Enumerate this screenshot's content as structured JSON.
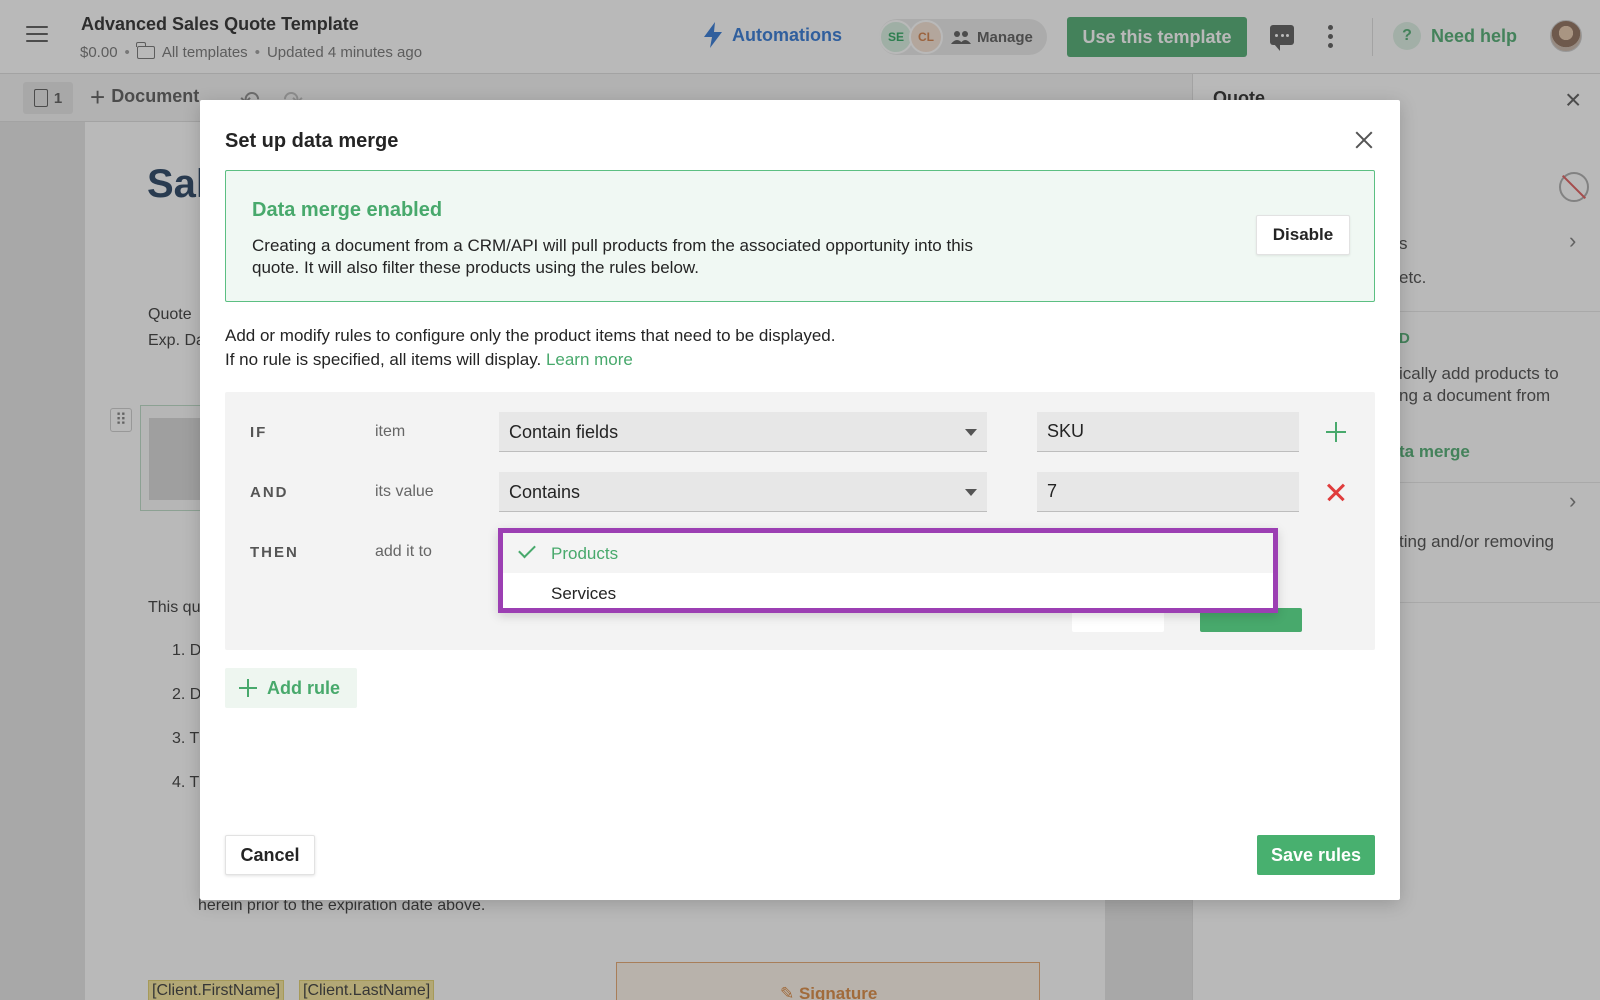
{
  "header": {
    "title": "Advanced Sales Quote Template",
    "price": "$0.00",
    "folder": "All templates",
    "updated": "Updated 4 minutes ago",
    "automations": "Automations",
    "collaborators": [
      "SE",
      "CL"
    ],
    "manage": "Manage",
    "use_template": "Use this template",
    "need_help": "Need help",
    "help_glyph": "?"
  },
  "toolbar": {
    "page_count": "1",
    "add_document": "Document"
  },
  "document": {
    "heading": "Sal",
    "quote_label": "Quote",
    "exp_label": "Exp. Da",
    "intro": "This qu",
    "list_items": [
      "1. D",
      "2. D",
      "3. T",
      "4. T"
    ],
    "closing": "herein prior to the expiration date above.",
    "merge_tags": [
      "[Client.FirstName]",
      "[Client.LastName]"
    ],
    "signature": "Signature"
  },
  "right_panel": {
    "title": "Quote",
    "snippet_1": "s",
    "snippet_2": "etc.",
    "snippet_3": "D",
    "snippet_4": "ically add products to",
    "snippet_5": "ng a document from",
    "snippet_6": "ta merge",
    "snippet_7": "ting and/or removing"
  },
  "modal": {
    "title": "Set up data merge",
    "enabled_title": "Data merge enabled",
    "enabled_desc": "Creating a document from a CRM/API will pull products from the associated opportunity into this quote. It will also filter these products using the rules below.",
    "disable": "Disable",
    "info_line_1": "Add or modify rules to configure only the product items that need to be displayed.",
    "info_line_2": "If no rule is specified, all items will display.",
    "learn_more": "Learn more",
    "rules": {
      "if_label": "IF",
      "if_sub": "item",
      "if_select": "Contain fields",
      "if_value": "SKU",
      "and_label": "AND",
      "and_sub": "its value",
      "and_select": "Contains",
      "and_value": "7",
      "then_label": "THEN",
      "then_sub": "add it to"
    },
    "dropdown_options": [
      {
        "label": "Products",
        "selected": true
      },
      {
        "label": "Services",
        "selected": false
      }
    ],
    "add_rule": "Add rule",
    "cancel": "Cancel",
    "save_rules": "Save rules"
  },
  "colors": {
    "brand_green": "#48a96c",
    "automation_blue": "#2a72d4",
    "dropdown_highlight": "#9c3fb3",
    "remove_red": "#e03c3c"
  }
}
